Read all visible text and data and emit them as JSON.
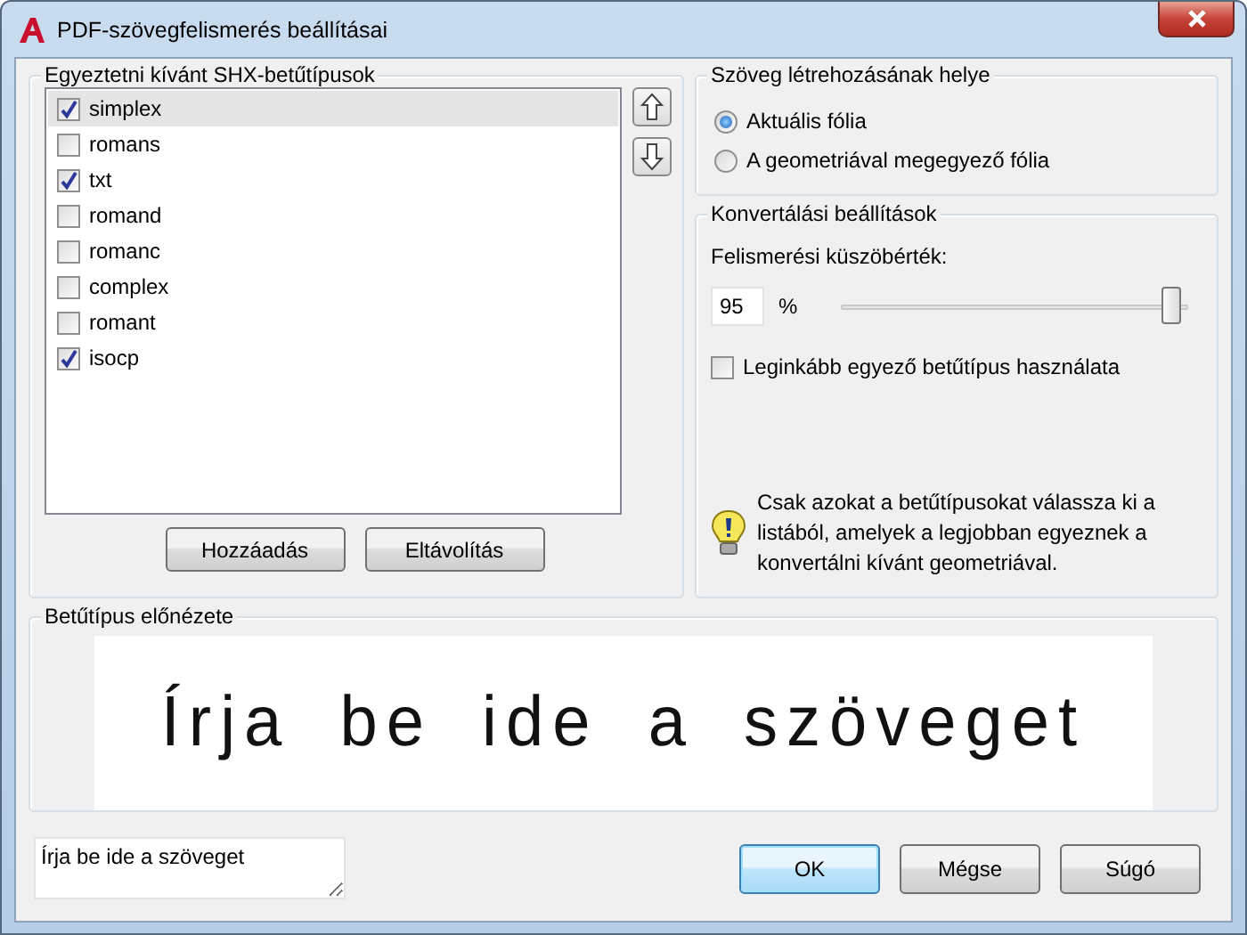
{
  "window": {
    "title": "PDF-szövegfelismerés beállításai"
  },
  "fonts_group": {
    "title": "Egyeztetni kívánt SHX-betűtípusok",
    "items": [
      {
        "label": "simplex",
        "checked": true,
        "selected": true
      },
      {
        "label": "romans",
        "checked": false,
        "selected": false
      },
      {
        "label": "txt",
        "checked": true,
        "selected": false
      },
      {
        "label": "romand",
        "checked": false,
        "selected": false
      },
      {
        "label": "romanc",
        "checked": false,
        "selected": false
      },
      {
        "label": "complex",
        "checked": false,
        "selected": false
      },
      {
        "label": "romant",
        "checked": false,
        "selected": false
      },
      {
        "label": "isocp",
        "checked": true,
        "selected": false
      }
    ],
    "buttons": [
      "Hozzáadás",
      "Eltávolítás"
    ]
  },
  "placement_group": {
    "title": "Szöveg létrehozásának helye",
    "options": [
      {
        "label": "Aktuális fólia",
        "selected": true
      },
      {
        "label": "A geometriával megegyező fólia",
        "selected": false
      }
    ]
  },
  "conversion_group": {
    "title": "Konvertálási beállítások",
    "threshold_label": "Felismerési küszöbérték:",
    "threshold_value": "95",
    "unit": "%",
    "slider": {
      "level": 0.95
    },
    "best_match": {
      "label": "Leginkább egyező betűtípus használata",
      "checked": false
    },
    "tip": "Csak azokat a betűtípusokat válassza ki a listából, amelyek a legjobban egyeznek a konvertálni kívánt geometriával."
  },
  "preview_group": {
    "title": "Betűtípus előnézete",
    "preview_text": "Írja be ide a szöveget"
  },
  "sample_input": {
    "value": "Írja be ide a szöveget"
  },
  "buttons": [
    {
      "label": "OK",
      "default": true
    },
    {
      "label": "Mégse",
      "default": false
    },
    {
      "label": "Súgó",
      "default": false
    }
  ]
}
